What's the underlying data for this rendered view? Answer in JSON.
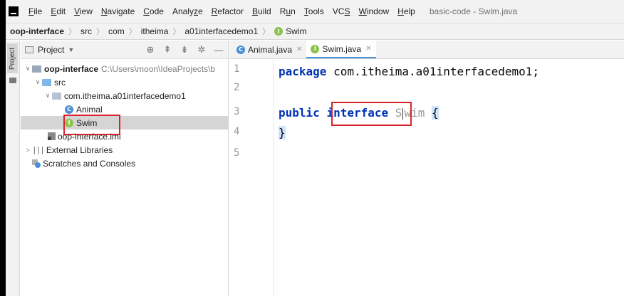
{
  "menubar": {
    "items": [
      "File",
      "Edit",
      "View",
      "Navigate",
      "Code",
      "Analyze",
      "Refactor",
      "Build",
      "Run",
      "Tools",
      "VCS",
      "Window",
      "Help"
    ],
    "mnemonics": [
      "F",
      "E",
      "V",
      "N",
      "C",
      "z",
      "R",
      "B",
      "u",
      "T",
      "S",
      "W",
      "H"
    ],
    "window_title": "basic-code - Swim.java"
  },
  "breadcrumb": {
    "items": [
      "oop-interface",
      "src",
      "com",
      "itheima",
      "a01interfacedemo1",
      "Swim"
    ]
  },
  "side_stripe": {
    "project_tab": "Project"
  },
  "project_pane": {
    "title": "Project",
    "tree": [
      {
        "label": "oop-interface",
        "path": "C:\\Users\\moon\\IdeaProjects\\b"
      },
      {
        "label": "src"
      },
      {
        "label": "com.itheima.a01interfacedemo1"
      },
      {
        "label": "Animal"
      },
      {
        "label": "Swim"
      },
      {
        "label": "oop-interface.iml"
      },
      {
        "label": "External Libraries"
      },
      {
        "label": "Scratches and Consoles"
      }
    ]
  },
  "editor": {
    "tabs": [
      {
        "label": "Animal.java"
      },
      {
        "label": "Swim.java"
      }
    ],
    "line_numbers": [
      "1",
      "2",
      "3",
      "4",
      "5"
    ],
    "code": {
      "line1_kw": "package",
      "line1_rest": " com.itheima.a01interfacedemo1;",
      "line3_kw1": "public",
      "line3_kw2": "interface",
      "line3_name_a": "S",
      "line3_name_b": "wim",
      "line3_brace": "{",
      "line4_brace": "}"
    }
  },
  "colors": {
    "keyword": "#0033b3",
    "highlight_box": "#d8232a",
    "interface_icon": "#8bc34a",
    "class_icon": "#4a8fd7"
  },
  "icons": {
    "interface": "I",
    "class": "C"
  }
}
